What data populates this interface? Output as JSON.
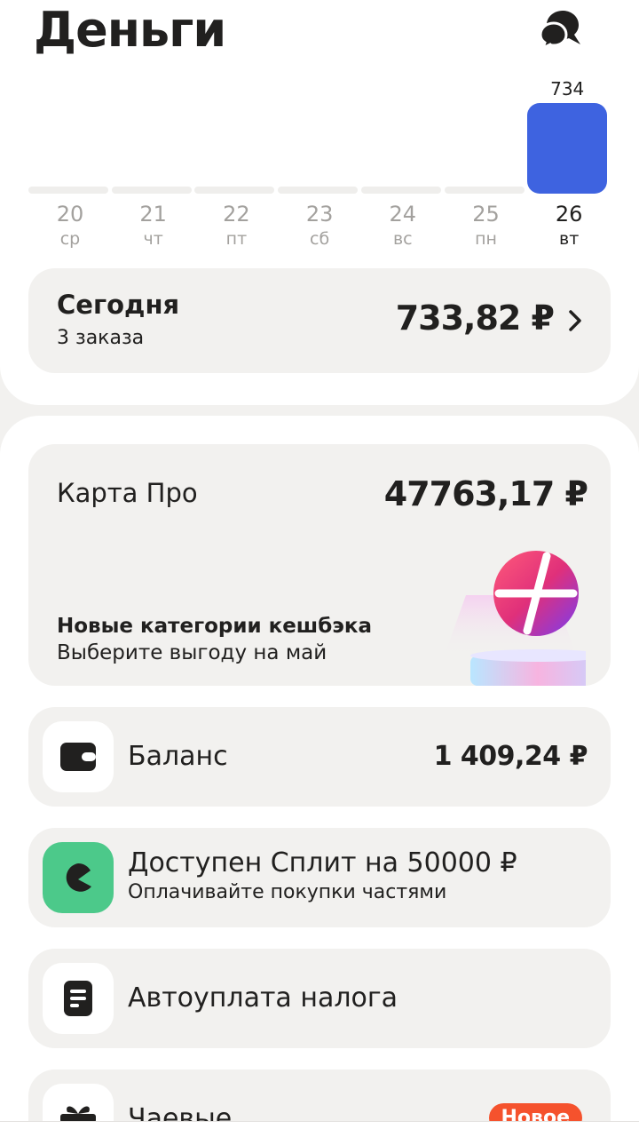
{
  "header": {
    "title": "Деньги",
    "support_icon": "chat-bubbles-icon"
  },
  "chart_data": {
    "type": "bar",
    "categories": [
      "20",
      "21",
      "22",
      "23",
      "24",
      "25",
      "26"
    ],
    "weekdays": [
      "ср",
      "чт",
      "пт",
      "сб",
      "вс",
      "пн",
      "вт"
    ],
    "values": [
      0,
      0,
      0,
      0,
      0,
      0,
      734
    ],
    "value_labels": [
      "",
      "",
      "",
      "",
      "",
      "",
      "734"
    ],
    "active_index": 6,
    "active_color": "#3e63e0",
    "title": "",
    "xlabel": "",
    "ylabel": ""
  },
  "today": {
    "label": "Сегодня",
    "orders": "3 заказа",
    "amount": "733,82 ₽"
  },
  "pro_card": {
    "label": "Карта Про",
    "amount": "47763,17 ₽",
    "promo_title": "Новые категории кешбэка",
    "promo_subtitle": "Выберите выгоду на май"
  },
  "balance": {
    "title": "Баланс",
    "amount": "1 409,24 ₽",
    "icon": "wallet-icon"
  },
  "split": {
    "title": "Доступен Сплит на 50000 ₽",
    "subtitle": "Оплачивайте покупки частями",
    "icon": "split-icon",
    "color": "#4cc98a"
  },
  "tax": {
    "title": "Автоуплата налога",
    "icon": "document-icon"
  },
  "tips": {
    "title": "Чаевые",
    "badge": "Новое",
    "icon": "gift-icon",
    "badge_color": "#f5522d"
  }
}
